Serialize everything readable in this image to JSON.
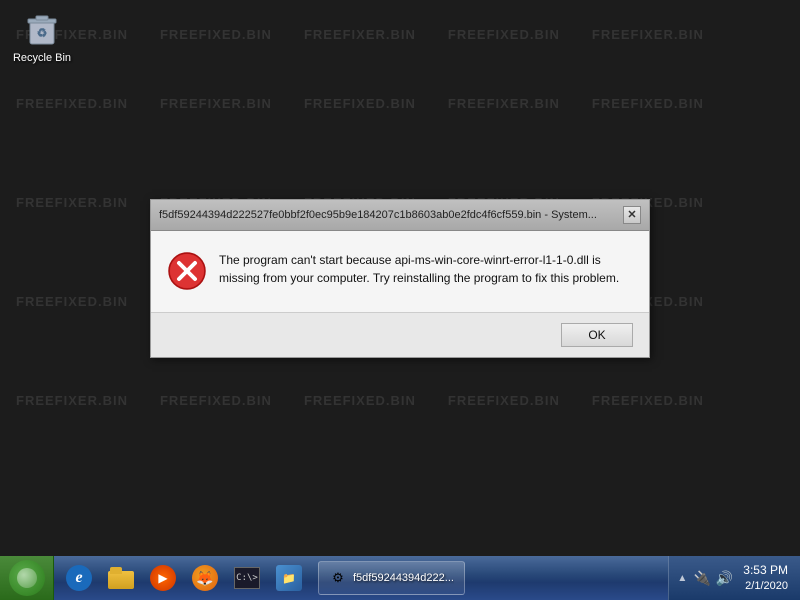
{
  "desktop": {
    "recycle_bin_label": "Recycle Bin"
  },
  "dialog": {
    "title": "f5df59244394d222527fe0bbf2f0ec95b9e184207c1b8603ab0e2fdc4f6cf559.bin - System...",
    "message": "The program can't start because api-ms-win-core-winrt-error-l1-1-0.dll is missing from your computer. Try reinstalling the program to fix this problem.",
    "ok_button": "OK"
  },
  "taskbar": {
    "clock_time": "3:53 PM",
    "clock_date": "2/1/2020",
    "task_label": "f5df59244394d222..."
  },
  "watermarks": [
    "FREEFIXER.BIN",
    "FREEFIXED.BIN",
    "FREEFIXER.BIN",
    "FREEFIXED.BIN",
    "FREEFIXER.BIN",
    "FREEFIXER.BIN",
    "FREEFIXED.BIN",
    "FREEFIXER.BIN",
    "FREEFIXED.BIN",
    "FREEFIXED.BIN"
  ]
}
